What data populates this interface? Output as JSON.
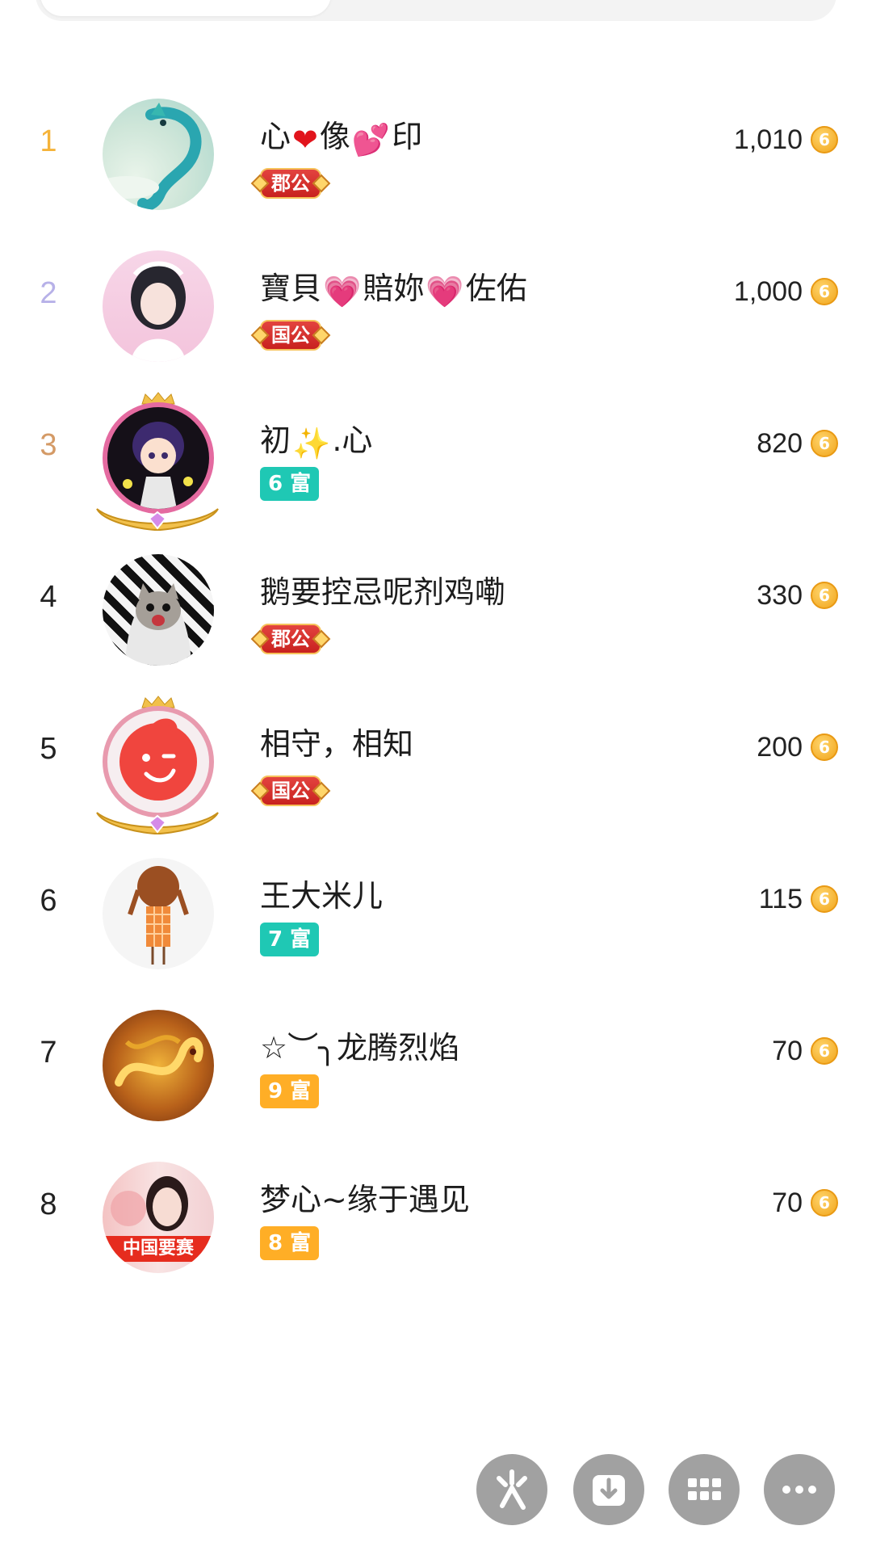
{
  "coin_icon": "coin-icon",
  "coin_glyph": "6",
  "colors": {
    "rank1": "#f5b33a",
    "rank2": "#b7b1e8",
    "rank3": "#d49a66",
    "rank_default": "#222222",
    "badge_teal": "#1fc8b4",
    "badge_orange": "#ffae26",
    "badge_title": "#d22c27"
  },
  "rows": [
    {
      "rank": "1",
      "name_parts": [
        "心",
        "❤",
        "像",
        "💕",
        "印"
      ],
      "badge": "郡公",
      "score": "1,010"
    },
    {
      "rank": "2",
      "name_parts": [
        "寶貝",
        "💗",
        "賠妳",
        "💗",
        "佐佑"
      ],
      "badge": "国公",
      "score": "1,000"
    },
    {
      "rank": "3",
      "name_parts": [
        "初",
        "✨",
        ".心"
      ],
      "badge": "6 富",
      "score": "820"
    },
    {
      "rank": "4",
      "name_parts": [
        "鹅要控忌呢剂鸡嘞"
      ],
      "badge": "郡公",
      "score": "330"
    },
    {
      "rank": "5",
      "name_parts": [
        "相守，相知"
      ],
      "badge": "国公",
      "score": "200"
    },
    {
      "rank": "6",
      "name_parts": [
        "王大米儿"
      ],
      "badge": "7 富",
      "score": "115"
    },
    {
      "rank": "7",
      "name_parts": [
        "☆︶╮龙腾烈焰"
      ],
      "badge": "9 富",
      "score": "70"
    },
    {
      "rank": "8",
      "name_parts": [
        "梦心~缘于遇见"
      ],
      "badge": "8 富",
      "score": "70",
      "avatar_caption": "中国要赛"
    }
  ],
  "fabs": [
    {
      "name": "sparkle-action-button",
      "icon": "sparkle-icon"
    },
    {
      "name": "download-button",
      "icon": "download-icon"
    },
    {
      "name": "apps-grid-button",
      "icon": "grid-icon"
    },
    {
      "name": "more-options-button",
      "icon": "more-dots-icon"
    }
  ]
}
